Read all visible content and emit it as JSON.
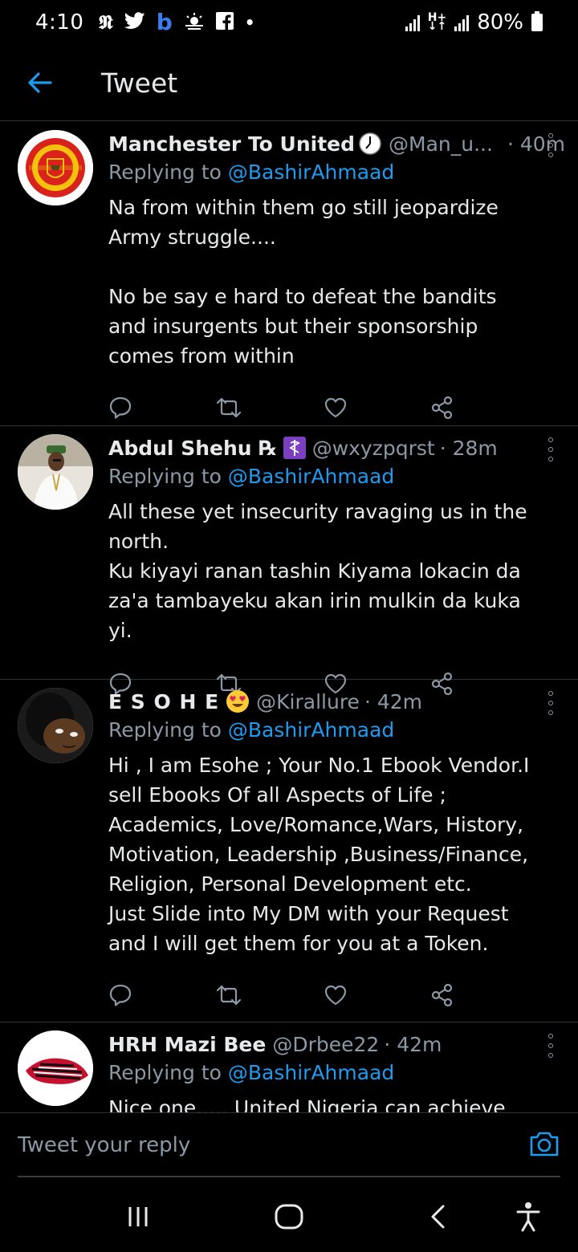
{
  "status_bar": {
    "time": "4:10",
    "battery": "80%",
    "icons": [
      "nytimes-icon",
      "twitter-icon",
      "b-icon",
      "weather-icon",
      "facebook-icon",
      "dot-icon"
    ]
  },
  "header": {
    "title": "Tweet"
  },
  "tweets": [
    {
      "name": "Manchester To United",
      "name_suffix_icon": "clock-icon",
      "handle": "@Man_u...",
      "time": "· 40m",
      "replying_prefix": "Replying to ",
      "replying_to": "@BashirAhmaad",
      "text": "Na from within them go still jeopardize Army struggle....\n\nNo be say e hard to defeat the bandits and insurgents but their sponsorship comes from within"
    },
    {
      "name": "Abdul Shehu ℞",
      "name_suffix_icon": "medical-icon",
      "handle": "@wxyzpqrst",
      "time": "· 28m",
      "replying_prefix": "Replying to ",
      "replying_to": "@BashirAhmaad",
      "text": "All these yet insecurity ravaging us in the north.\nKu kiyayi ranan tashin Kiyama lokacin da za'a tambayeku akan irin mulkin da kuka yi."
    },
    {
      "name": "E S O H E",
      "name_suffix_icon": "heart-eyes-emoji-icon",
      "handle": "@Kirallure",
      "time": "· 42m",
      "replying_prefix": "Replying to ",
      "replying_to": "@BashirAhmaad",
      "text": "Hi , I am Esohe ; Your No.1 Ebook Vendor.I sell Ebooks Of all Aspects of Life ; Academics, Love/Romance,Wars, History, Motivation, Leadership ,Business/Finance, Religion, Personal Development etc.\nJust Slide into My DM with your Request and I will get them for you at a Token."
    },
    {
      "name": "HRH Mazi Bee",
      "name_suffix_icon": "",
      "handle": "@Drbee22",
      "time": "· 42m",
      "replying_prefix": "Replying to ",
      "replying_to": "@BashirAhmaad",
      "text": "Nice one..... United Nigeria can achieve"
    }
  ],
  "reply_bar": {
    "placeholder": "Tweet your reply"
  },
  "colors": {
    "background": "#000000",
    "accent": "#1d9bf0",
    "muted": "#8b98a5",
    "divider": "#2f3336"
  }
}
